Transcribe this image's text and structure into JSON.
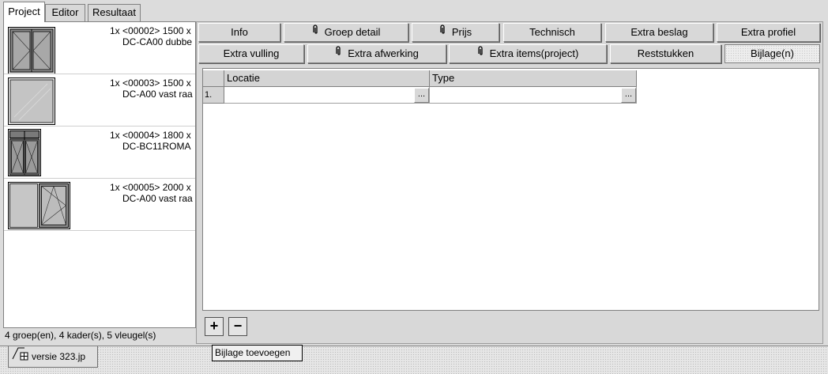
{
  "top_tabs": [
    {
      "label": "Project",
      "active": true
    },
    {
      "label": "Editor",
      "active": false
    },
    {
      "label": "Resultaat",
      "active": false
    }
  ],
  "project_list": [
    {
      "line1": "1x <00002> 1500 x",
      "line2": "DC-CA00 dubbe"
    },
    {
      "line1": "1x <00003> 1500 x",
      "line2": "DC-A00 vast raa"
    },
    {
      "line1": "1x <00004> 1800 x",
      "line2": "DC-BC11ROMA"
    },
    {
      "line1": "1x <00005> 2000 x",
      "line2": "DC-A00 vast raa"
    }
  ],
  "status": "4 groep(en), 4 kader(s), 5 vleugel(s)",
  "detail_tabs_row1": [
    {
      "label": "Info"
    },
    {
      "label": "Groep detail",
      "icon": "paperclip-icon"
    },
    {
      "label": "Prijs",
      "icon": "paperclip-icon"
    },
    {
      "label": "Technisch"
    },
    {
      "label": "Extra beslag"
    },
    {
      "label": "Extra profiel"
    }
  ],
  "detail_tabs_row2": [
    {
      "label": "Extra vulling"
    },
    {
      "label": "Extra afwerking",
      "icon": "paperclip-icon"
    },
    {
      "label": "Extra items(project)",
      "icon": "paperclip-icon"
    },
    {
      "label": "Reststukken"
    },
    {
      "label": "Bijlage(n)",
      "active": true
    }
  ],
  "grid": {
    "columns": [
      "Locatie",
      "Type"
    ],
    "rows": [
      {
        "num": "1.",
        "locatie": "",
        "type": ""
      }
    ],
    "ellipsis": "..."
  },
  "buttons": {
    "add": "+",
    "remove": "−"
  },
  "version_tab": {
    "label": "versie 323.jp"
  },
  "tooltip": "Bijlage toevoegen"
}
